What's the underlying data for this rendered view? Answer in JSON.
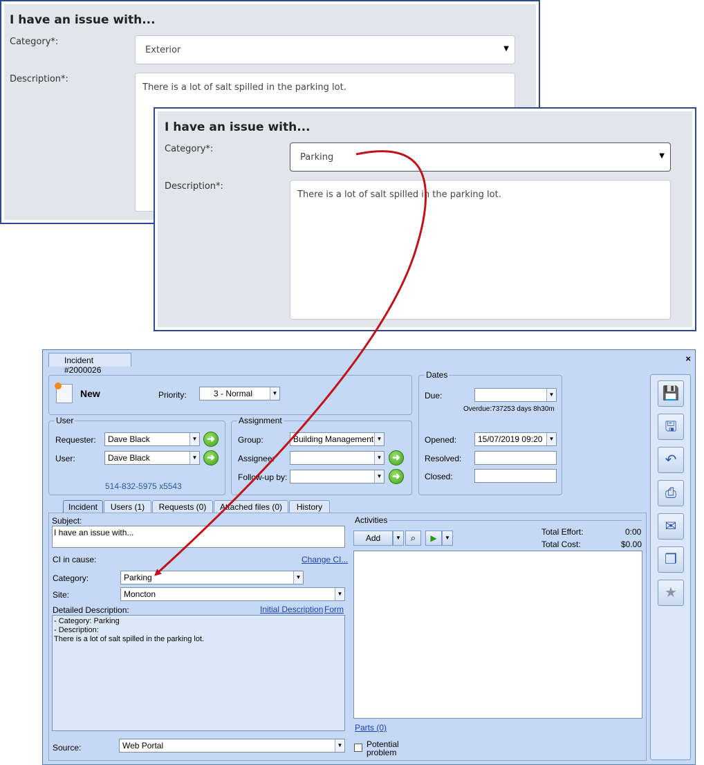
{
  "web_form_1": {
    "title": "I have an issue with...",
    "category_label": "Category*:",
    "category_value": "Exterior",
    "description_label": "Description*:",
    "description_value": "There is a lot of salt spilled in the parking lot."
  },
  "web_form_2": {
    "title": "I have an issue with...",
    "category_label": "Category*:",
    "category_value": "Parking",
    "description_label": "Description*:",
    "description_value": "There is a lot of salt spilled in the parking lot."
  },
  "annotation": {
    "arrow_color": "#c0121a"
  },
  "app": {
    "tab_title": "Incident #2000026",
    "close": "×",
    "status": "New",
    "priority_label": "Priority:",
    "priority_value": "3 - Normal",
    "user_group": {
      "title": "User",
      "requester_label": "Requester:",
      "requester_value": "Dave Black",
      "user_label": "User:",
      "user_value": "Dave Black",
      "phone": "514-832-5975 x5543"
    },
    "assignment": {
      "title": "Assignment",
      "group_label": "Group:",
      "group_value": "Building Management",
      "assignee_label": "Assignee:",
      "assignee_value": "",
      "followup_label": "Follow-up by:",
      "followup_value": ""
    },
    "dates": {
      "title": "Dates",
      "due_label": "Due:",
      "due_value": "",
      "overdue": "Overdue:737253 days 8h30m",
      "opened_label": "Opened:",
      "opened_value": "15/07/2019 09:20",
      "resolved_label": "Resolved:",
      "closed_label": "Closed:"
    },
    "tabs": [
      {
        "label": "Incident"
      },
      {
        "label": "Users (1)"
      },
      {
        "label": "Requests (0)"
      },
      {
        "label": "Attached files (0)"
      },
      {
        "label": "History"
      }
    ],
    "incident": {
      "subject_label": "Subject:",
      "subject_value": "I have an issue with...",
      "ci_label": "CI in cause:",
      "change_ci": "Change CI...",
      "category_label": "Category:",
      "category_value": "Parking",
      "site_label": "Site:",
      "site_value": "Moncton",
      "detailed_label": "Detailed Description:",
      "initial_description": "Initial Description",
      "form_link": "Form",
      "detail_line1": "- Category: Parking",
      "detail_line2": "- Description:",
      "detail_line3": "There is a lot of salt spilled in the parking lot.",
      "source_label": "Source:",
      "source_value": "Web Portal"
    },
    "activities": {
      "title": "Activities",
      "add_label": "Add",
      "total_effort_label": "Total Effort:",
      "total_effort_value": "0:00",
      "total_cost_label": "Total Cost:",
      "total_cost_value": "$0.00",
      "parts_link": "Parts (0)",
      "potential_problem_line1": "Potential",
      "potential_problem_line2": "problem"
    },
    "toolbar_icons": [
      "save-icon",
      "save-and-close-icon",
      "undo-icon",
      "print-icon",
      "email-icon",
      "copy-icon",
      "favorite-star-icon"
    ]
  }
}
